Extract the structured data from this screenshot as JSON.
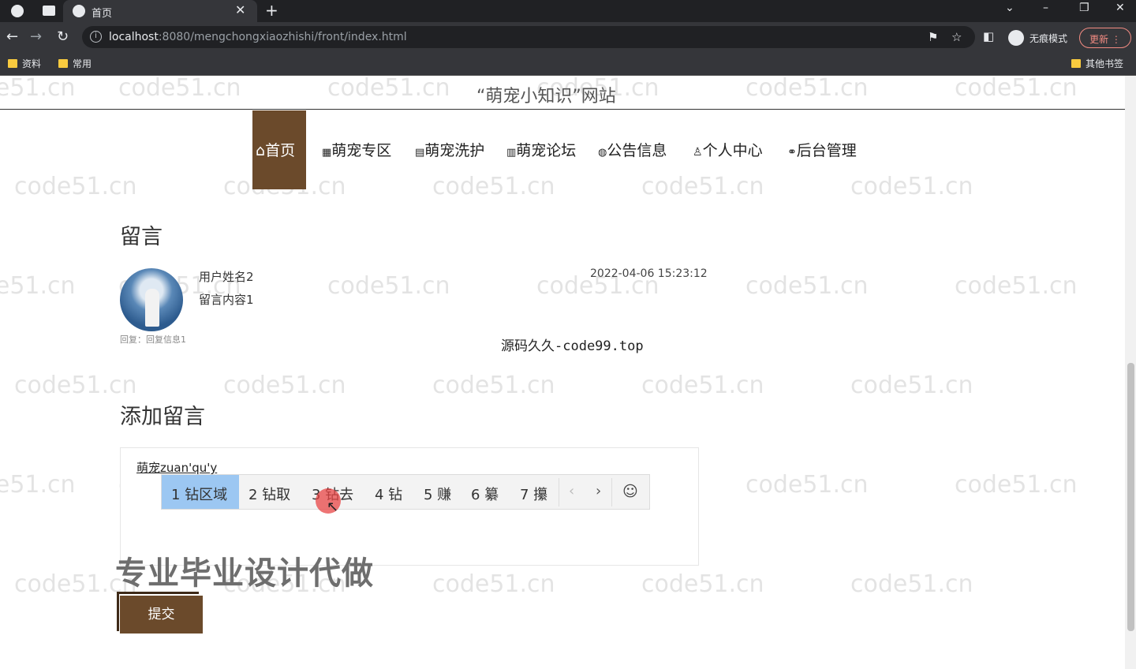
{
  "browser": {
    "tab_title": "首页",
    "tab_close": "✕",
    "new_tab": "+",
    "url_host": "localhost",
    "url_path": ":8080/mengchongxiaozhishi/front/index.html",
    "incognito_label": "无痕模式",
    "update_label": "更新",
    "bookmarks": [
      "资料",
      "常用"
    ],
    "other_bookmarks": "其他书签"
  },
  "site": {
    "title": "“萌宠小知识”网站",
    "nav": [
      {
        "icon": "⌂",
        "label": "首页"
      },
      {
        "icon": "▦",
        "label": "萌宠专区"
      },
      {
        "icon": "▤",
        "label": "萌宠洗护"
      },
      {
        "icon": "▥",
        "label": "萌宠论坛"
      },
      {
        "icon": "◍",
        "label": "公告信息"
      },
      {
        "icon": "♙",
        "label": "个人中心"
      },
      {
        "icon": "⚭",
        "label": "后台管理"
      }
    ]
  },
  "messages": {
    "heading": "留言",
    "items": [
      {
        "user": "用户姓名2",
        "content": "留言内容1",
        "time": "2022-04-06 15:23:12",
        "reply": "回复：回复信息1"
      }
    ],
    "promo": "源码久久-code99.top"
  },
  "add_message": {
    "heading": "添加留言",
    "input_value": "萌宠zuan'qu'y",
    "submit_label": "提交"
  },
  "ime": {
    "candidates": [
      "1 钻区域",
      "2 钻取",
      "3 钻去",
      "4 钻",
      "5 赚",
      "6 纂",
      "7 攥"
    ],
    "prev": "‹",
    "next": "›",
    "emoji": "☺"
  },
  "overlay_text": "专业毕业设计代做",
  "watermark": "code51.cn"
}
